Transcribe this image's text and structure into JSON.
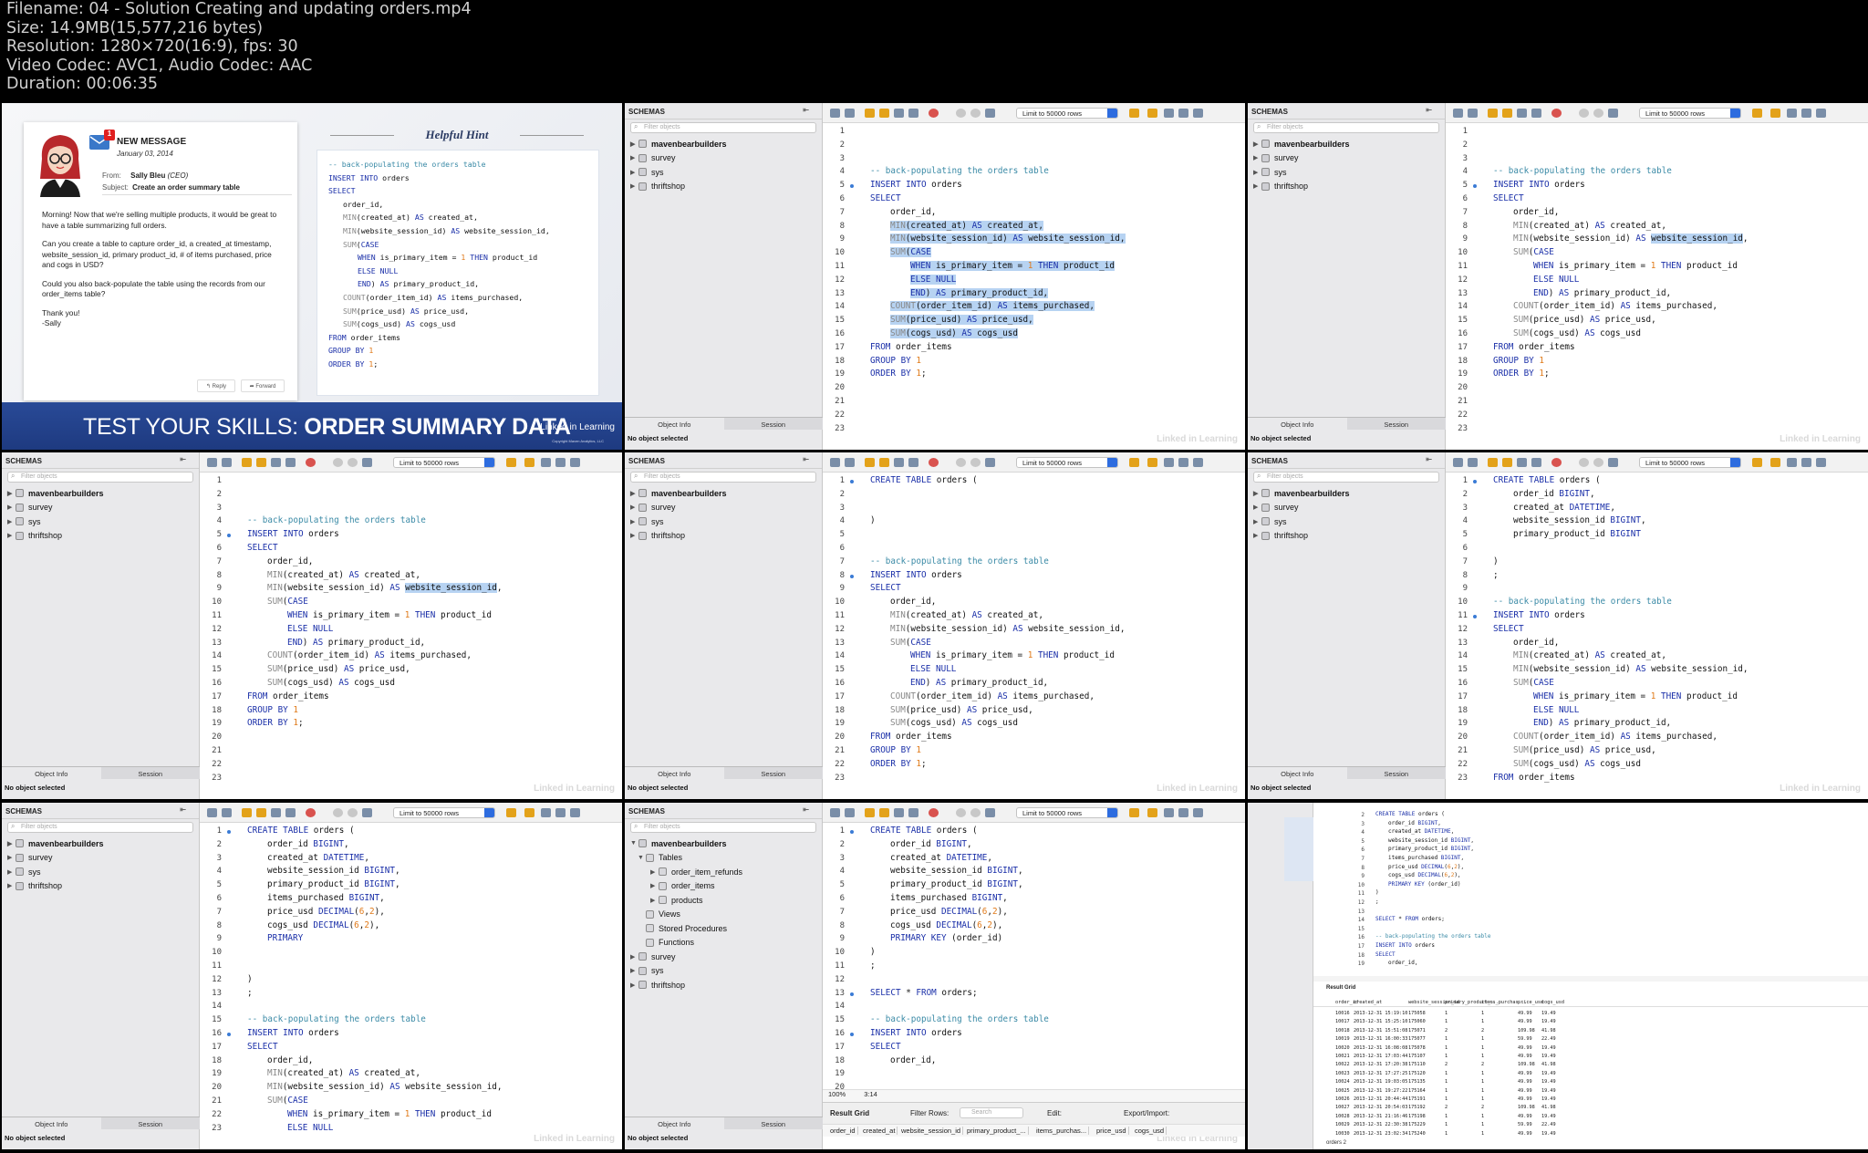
{
  "header": {
    "filename": "Filename: 04 - Solution Creating and updating orders.mp4",
    "size": "Size: 14.9MB(15,577,216 bytes)",
    "resolution": "Resolution: 1280×720(16:9), fps: 30",
    "codec": "Video Codec: AVC1, Audio Codec: AAC",
    "duration": "Duration: 00:06:35"
  },
  "slide": {
    "msg_badge": "1",
    "msg_title": "NEW MESSAGE",
    "msg_date": "January 03, 2014",
    "from_label": "From:",
    "from_name": "Sally Bleu",
    "from_role": "(CEO)",
    "subject_label": "Subject:",
    "subject": "Create an order summary table",
    "body": [
      "Morning! Now that we're selling multiple products, it would be great to have a table summarizing full orders.",
      "Can you create a table to capture order_id, a created_at timestamp, website_session_id, primary product_id, # of items purchased, price and cogs in USD?",
      "Could you also back-populate the table using the records from our order_items table?",
      "Thank you!\n-Sally"
    ],
    "reply": "Reply",
    "forward": "Forward",
    "hint_title": "Helpful Hint",
    "banner_a": "TEST YOUR SKILLS: ",
    "banner_b": "ORDER SUMMARY DATA",
    "brand": "Linked in Learning",
    "copyright": "Copyright Maven Analytics, LLC"
  },
  "workbench": {
    "schemas_title": "SCHEMAS",
    "filter": "Filter objects",
    "limit": "Limit to 50000 rows",
    "tree": [
      "mavenbearbuilders",
      "survey",
      "sys",
      "thriftshop"
    ],
    "tree_tables": [
      "Tables",
      "order_item_refunds",
      "order_items",
      "products",
      "Views",
      "Stored Procedures",
      "Functions"
    ],
    "tab_info": "Object Info",
    "tab_session": "Session",
    "no_object": "No object selected",
    "watermark": "Linked in Learning",
    "zoom": "100%",
    "cursor_pos": "3:14",
    "result_grid": "Result Grid",
    "filter_rows": "Filter Rows:",
    "search": "Search",
    "edit": "Edit:",
    "export": "Export/Import:",
    "result_cols": [
      "order_id",
      "created_at",
      "website_session_id",
      "primary_product_...",
      "items_purchas...",
      "price_usd",
      "cogs_usd"
    ],
    "tab_orders2": "orders 2"
  },
  "sql": {
    "comment": "-- back-populating the orders table",
    "insert": "INSERT INTO orders",
    "select": "SELECT",
    "col_order_id": "order_id,",
    "col_created": "MIN(created_at) AS created_at,",
    "col_session": "MIN(website_session_id) AS website_session_id,",
    "sum_case": "SUM(CASE",
    "when": "WHEN is_primary_item = 1 THEN product_id",
    "else": "ELSE NULL",
    "end": "END) AS primary_product_id,",
    "count": "COUNT(order_item_id) AS items_purchased,",
    "price": "SUM(price_usd) AS price_usd,",
    "cogs": "SUM(cogs_usd) AS cogs_usd",
    "from": "FROM order_items",
    "group": "GROUP BY 1",
    "order": "ORDER BY 1;",
    "create": "CREATE TABLE orders (",
    "d_order": "order_id BIGINT,",
    "d_created": "created_at DATETIME,",
    "d_session": "website_session_id BIGINT,",
    "d_primary": "primary_product_id BIGINT,",
    "d_primary_nc": "primary_product_id BIGINT",
    "d_items": "items_purchased BIGINT,",
    "d_price": "price_usd DECIMAL(6,2),",
    "d_cogs": "cogs_usd DECIMAL(6,2),",
    "primary_key": "PRIMARY KEY (order_id)",
    "primary_typing": "PRIMARY ",
    "close": ")",
    "semi": ";",
    "select_all": "SELECT * FROM orders;",
    "h_group": "GROUP BY 1",
    "h_order": "ORDER BY 1;"
  },
  "grid_rows": [
    [
      "10016",
      "2013-12-31 15:19:10",
      "175058",
      "1",
      "1",
      "49.99",
      "19.49"
    ],
    [
      "10017",
      "2013-12-31 15:25:10",
      "175060",
      "1",
      "1",
      "49.99",
      "19.49"
    ],
    [
      "10018",
      "2013-12-31 15:51:08",
      "175071",
      "2",
      "2",
      "109.98",
      "41.98"
    ],
    [
      "10019",
      "2013-12-31 16:00:33",
      "175077",
      "1",
      "1",
      "59.99",
      "22.49"
    ],
    [
      "10020",
      "2013-12-31 16:08:08",
      "175078",
      "1",
      "1",
      "49.99",
      "19.49"
    ],
    [
      "10021",
      "2013-12-31 17:03:44",
      "175107",
      "1",
      "1",
      "49.99",
      "19.49"
    ],
    [
      "10022",
      "2013-12-31 17:20:38",
      "175110",
      "2",
      "2",
      "109.98",
      "41.98"
    ],
    [
      "10023",
      "2013-12-31 17:27:25",
      "175120",
      "1",
      "1",
      "49.99",
      "19.49"
    ],
    [
      "10024",
      "2013-12-31 19:03:05",
      "175135",
      "1",
      "1",
      "49.99",
      "19.49"
    ],
    [
      "10025",
      "2013-12-31 19:27:22",
      "175164",
      "1",
      "1",
      "49.99",
      "19.49"
    ],
    [
      "10026",
      "2013-12-31 20:44:44",
      "175191",
      "1",
      "1",
      "49.99",
      "19.49"
    ],
    [
      "10027",
      "2013-12-31 20:54:03",
      "175192",
      "2",
      "2",
      "109.98",
      "41.98"
    ],
    [
      "10028",
      "2013-12-31 21:16:46",
      "175198",
      "1",
      "1",
      "49.99",
      "19.49"
    ],
    [
      "10029",
      "2013-12-31 22:30:38",
      "175229",
      "1",
      "1",
      "59.99",
      "22.49"
    ],
    [
      "10030",
      "2013-12-31 23:02:34",
      "175240",
      "1",
      "1",
      "49.99",
      "19.49"
    ]
  ]
}
